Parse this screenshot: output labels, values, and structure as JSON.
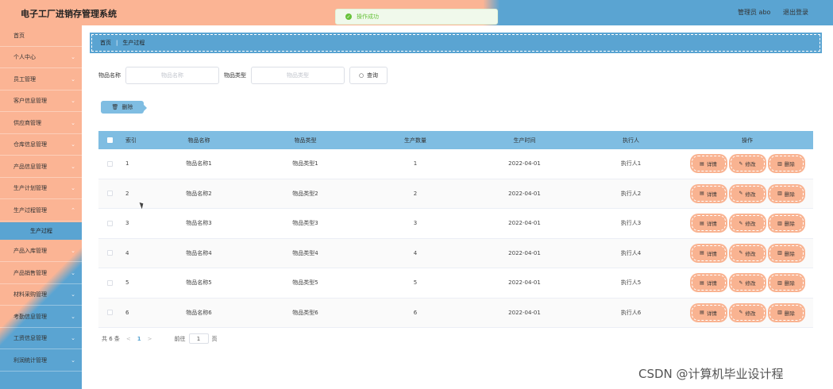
{
  "header": {
    "title": "电子工厂进销存管理系统",
    "admin": "管理员 abo",
    "logout": "退出登录"
  },
  "toast": {
    "message": "操作成功"
  },
  "sidebar": {
    "items": [
      {
        "label": "首页",
        "chev": ""
      },
      {
        "label": "个人中心",
        "chev": "⌄"
      },
      {
        "label": "员工管理",
        "chev": "⌄"
      },
      {
        "label": "客户信息管理",
        "chev": "⌄"
      },
      {
        "label": "供应商管理",
        "chev": "⌄"
      },
      {
        "label": "仓库信息管理",
        "chev": "⌄"
      },
      {
        "label": "产品信息管理",
        "chev": "⌄"
      },
      {
        "label": "生产计划管理",
        "chev": "⌄"
      },
      {
        "label": "生产过程管理",
        "chev": "⌃"
      }
    ],
    "sub": "生产过程",
    "items2": [
      {
        "label": "产品入库管理",
        "chev": "⌄"
      },
      {
        "label": "产品销售管理",
        "chev": "⌄"
      },
      {
        "label": "材料采购管理",
        "chev": "⌄"
      },
      {
        "label": "考勤信息管理",
        "chev": "⌄"
      },
      {
        "label": "工资信息管理",
        "chev": "⌄"
      },
      {
        "label": "利润统计管理",
        "chev": "⌄"
      }
    ]
  },
  "breadcrumb": {
    "home": "首页",
    "sep": "|",
    "current": "生产过程"
  },
  "search": {
    "name_label": "物品名称",
    "name_placeholder": "物品名称",
    "type_label": "物品类型",
    "type_placeholder": "物品类型",
    "query_label": "查询"
  },
  "toolbar": {
    "delete_label": "删除"
  },
  "table": {
    "headers": [
      "索引",
      "物品名称",
      "物品类型",
      "生产数量",
      "生产时间",
      "执行人",
      "操作"
    ],
    "rows": [
      {
        "idx": "1",
        "name": "物品名称1",
        "type": "物品类型1",
        "qty": "1",
        "time": "2022-04-01",
        "exec": "执行人1"
      },
      {
        "idx": "2",
        "name": "物品名称2",
        "type": "物品类型2",
        "qty": "2",
        "time": "2022-04-01",
        "exec": "执行人2"
      },
      {
        "idx": "3",
        "name": "物品名称3",
        "type": "物品类型3",
        "qty": "3",
        "time": "2022-04-01",
        "exec": "执行人3"
      },
      {
        "idx": "4",
        "name": "物品名称4",
        "type": "物品类型4",
        "qty": "4",
        "time": "2022-04-01",
        "exec": "执行人4"
      },
      {
        "idx": "5",
        "name": "物品名称5",
        "type": "物品类型5",
        "qty": "5",
        "time": "2022-04-01",
        "exec": "执行人5"
      },
      {
        "idx": "6",
        "name": "物品名称6",
        "type": "物品类型6",
        "qty": "6",
        "time": "2022-04-01",
        "exec": "执行人6"
      }
    ],
    "actions": {
      "detail": "详情",
      "edit": "修改",
      "delete": "删除"
    }
  },
  "pager": {
    "total": "共 6 条",
    "prev": "<",
    "page": "1",
    "next": ">",
    "goto": "前往",
    "goto_value": "1",
    "page_unit": "页"
  },
  "watermark": "CSDN @计算机毕业设计程"
}
